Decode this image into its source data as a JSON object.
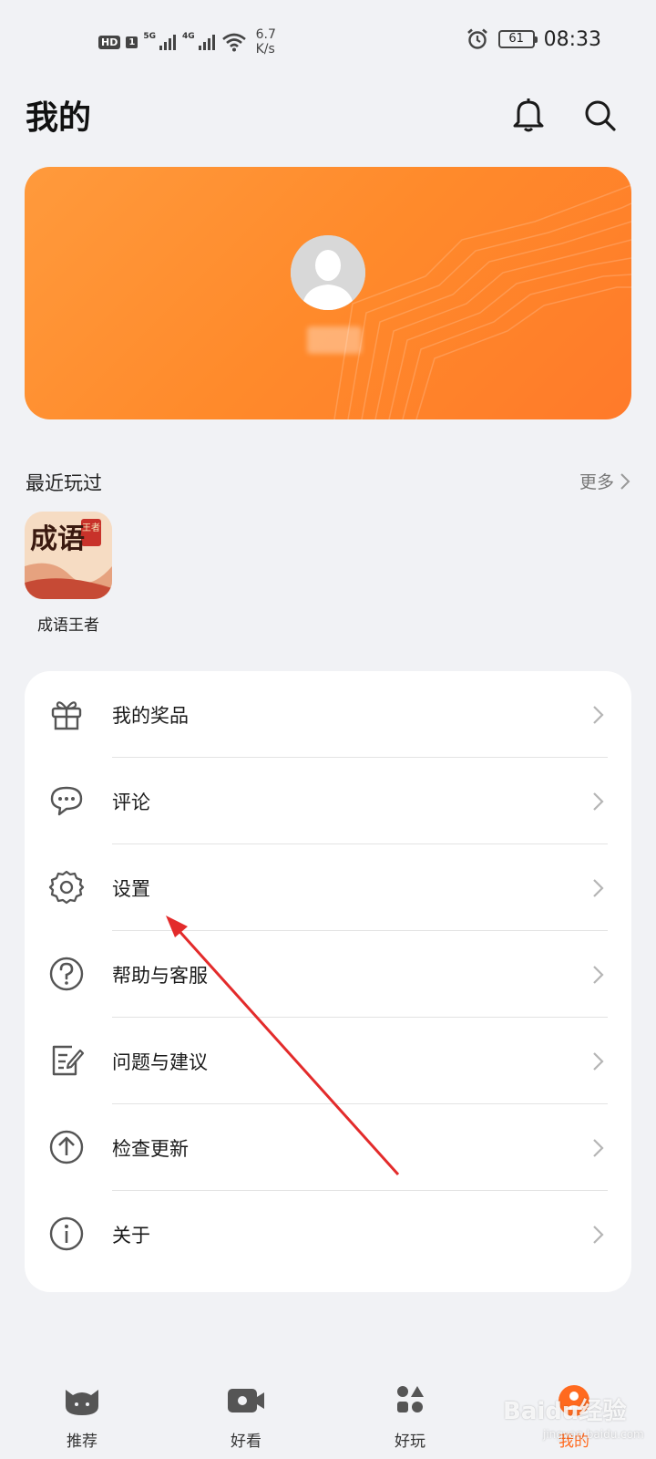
{
  "status_bar": {
    "hd": "HD",
    "sim": "1",
    "net1": "5G",
    "net2": "4G",
    "speed_value": "6.7",
    "speed_unit": "K/s",
    "battery": "61",
    "time": "08:33"
  },
  "header": {
    "title": "我的",
    "bell_icon": "bell-icon",
    "search_icon": "search-icon"
  },
  "recent": {
    "title": "最近玩过",
    "more": "更多",
    "games": [
      {
        "name": "成语王者",
        "icon_text": "成语",
        "badge": "王者"
      }
    ]
  },
  "menu": [
    {
      "label": "我的奖品",
      "icon": "gift-icon"
    },
    {
      "label": "评论",
      "icon": "comment-icon"
    },
    {
      "label": "设置",
      "icon": "gear-icon"
    },
    {
      "label": "帮助与客服",
      "icon": "help-icon"
    },
    {
      "label": "问题与建议",
      "icon": "feedback-icon"
    },
    {
      "label": "检查更新",
      "icon": "update-icon"
    },
    {
      "label": "关于",
      "icon": "info-icon"
    }
  ],
  "tabs": [
    {
      "label": "推荐",
      "icon": "recommend-icon"
    },
    {
      "label": "好看",
      "icon": "video-icon"
    },
    {
      "label": "好玩",
      "icon": "games-icon"
    },
    {
      "label": "我的",
      "icon": "me-icon",
      "active": true
    }
  ],
  "watermark": "Baidu经验",
  "watermark_sub": "jingyan.baidu.com",
  "colors": {
    "accent": "#ff7a2a",
    "background": "#f1f2f5",
    "annotation_arrow": "#e32b2b"
  }
}
